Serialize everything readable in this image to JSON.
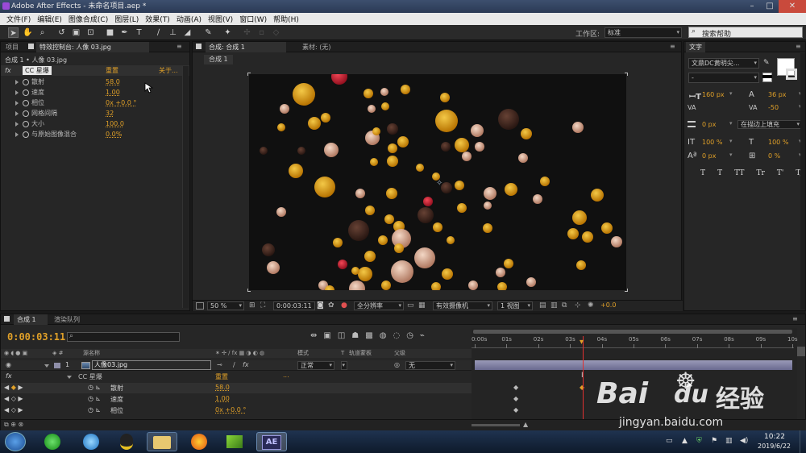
{
  "window": {
    "title": "Adobe After Effects - 未命名项目.aep *",
    "minimize": "–",
    "maximize": "□",
    "close": "✕"
  },
  "menu": [
    "文件(F)",
    "编辑(E)",
    "图像合成(C)",
    "图层(L)",
    "效果(T)",
    "动画(A)",
    "视图(V)",
    "窗口(W)",
    "帮助(H)"
  ],
  "toolbar": {
    "workspace_label": "工作区:",
    "workspace_value": "标准",
    "search_placeholder": "搜索帮助"
  },
  "project_panel": {
    "tab_project": "项目",
    "tab_effects": "特效控制台: 人像 03.jpg",
    "breadcrumb": "合成 1 • 人像 03.jpg",
    "effect_name": "CC 星爆",
    "reset": "重置",
    "about": "关于...",
    "params": [
      {
        "name": "散射",
        "value": "58.0"
      },
      {
        "name": "速度",
        "value": "1.00"
      },
      {
        "name": "相位",
        "value": "0x +0.0 °"
      },
      {
        "name": "网格间隔",
        "value": "32"
      },
      {
        "name": "大小",
        "value": "100.0"
      },
      {
        "name": "与原始图像混合",
        "value": "0.0%"
      }
    ]
  },
  "comp_panel": {
    "tab_comp": "合成: 合成 1",
    "tab_footage": "素材: (无)",
    "subtab": "合成 1",
    "zoom": "50 %",
    "timecode": "0:00:03:11",
    "resolution": "全分辨率",
    "camera": "有效摄像机",
    "views": "1 视图",
    "exposure": "+0.0"
  },
  "text_panel": {
    "title": "文字",
    "font": "文鼎DC黄明尖...",
    "style": "-",
    "font_size": "160 px",
    "leading": "36 px",
    "tracking_left": "VA",
    "tracking": "-50",
    "stroke": "0 px",
    "stroke_mode": "在描边上填充",
    "vscale": "100 %",
    "hscale": "100 %",
    "baseline": "0 px",
    "tsume": "0 %",
    "format_buttons": [
      "T",
      "T",
      "TT",
      "Tr",
      "T'",
      "T,"
    ]
  },
  "timeline": {
    "tab_comp": "合成 1",
    "tab_render": "渲染队列",
    "timecode": "0:00:03:11",
    "col_source": "源名称",
    "col_mode": "模式",
    "col_t": "T",
    "col_trkmat": "轨道蒙板",
    "col_parent": "父级",
    "layer_num": "1",
    "layer_name": "人像03.jpg",
    "layer_mode": "正常",
    "layer_parent": "无",
    "fx_label": "fx",
    "effect_name": "CC 星爆",
    "reset": "重置",
    "dots": "...",
    "props": [
      {
        "name": "散射",
        "value": "58.0"
      },
      {
        "name": "速度",
        "value": "1.00"
      },
      {
        "name": "相位",
        "value": "0x +0.0 °"
      }
    ],
    "ruler": [
      "0:00s",
      "01s",
      "02s",
      "03s",
      "04s",
      "05s",
      "06s",
      "07s",
      "08s",
      "09s",
      "10s"
    ],
    "playhead_fraction": 0.34
  },
  "taskbar": {
    "time": "10:22",
    "date": "2019/6/22",
    "ae_label": "AE"
  },
  "watermark": {
    "brand": "Bai",
    "brand2": "du",
    "cn": "经验",
    "url": "jingyan.baidu.com"
  },
  "colors": {
    "accent": "#e0a028",
    "bg": "#262626",
    "panel_dark": "#1f1f1f"
  }
}
